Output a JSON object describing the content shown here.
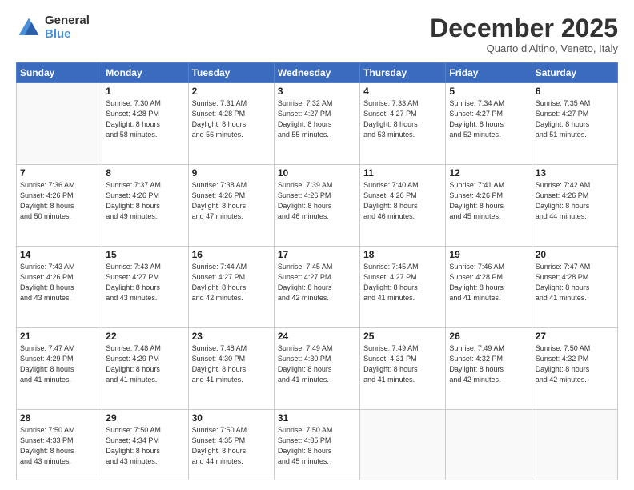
{
  "logo": {
    "general": "General",
    "blue": "Blue"
  },
  "header": {
    "month": "December 2025",
    "location": "Quarto d'Altino, Veneto, Italy"
  },
  "weekdays": [
    "Sunday",
    "Monday",
    "Tuesday",
    "Wednesday",
    "Thursday",
    "Friday",
    "Saturday"
  ],
  "weeks": [
    [
      {
        "day": "",
        "info": ""
      },
      {
        "day": "1",
        "info": "Sunrise: 7:30 AM\nSunset: 4:28 PM\nDaylight: 8 hours\nand 58 minutes."
      },
      {
        "day": "2",
        "info": "Sunrise: 7:31 AM\nSunset: 4:28 PM\nDaylight: 8 hours\nand 56 minutes."
      },
      {
        "day": "3",
        "info": "Sunrise: 7:32 AM\nSunset: 4:27 PM\nDaylight: 8 hours\nand 55 minutes."
      },
      {
        "day": "4",
        "info": "Sunrise: 7:33 AM\nSunset: 4:27 PM\nDaylight: 8 hours\nand 53 minutes."
      },
      {
        "day": "5",
        "info": "Sunrise: 7:34 AM\nSunset: 4:27 PM\nDaylight: 8 hours\nand 52 minutes."
      },
      {
        "day": "6",
        "info": "Sunrise: 7:35 AM\nSunset: 4:27 PM\nDaylight: 8 hours\nand 51 minutes."
      }
    ],
    [
      {
        "day": "7",
        "info": "Sunrise: 7:36 AM\nSunset: 4:26 PM\nDaylight: 8 hours\nand 50 minutes."
      },
      {
        "day": "8",
        "info": "Sunrise: 7:37 AM\nSunset: 4:26 PM\nDaylight: 8 hours\nand 49 minutes."
      },
      {
        "day": "9",
        "info": "Sunrise: 7:38 AM\nSunset: 4:26 PM\nDaylight: 8 hours\nand 47 minutes."
      },
      {
        "day": "10",
        "info": "Sunrise: 7:39 AM\nSunset: 4:26 PM\nDaylight: 8 hours\nand 46 minutes."
      },
      {
        "day": "11",
        "info": "Sunrise: 7:40 AM\nSunset: 4:26 PM\nDaylight: 8 hours\nand 46 minutes."
      },
      {
        "day": "12",
        "info": "Sunrise: 7:41 AM\nSunset: 4:26 PM\nDaylight: 8 hours\nand 45 minutes."
      },
      {
        "day": "13",
        "info": "Sunrise: 7:42 AM\nSunset: 4:26 PM\nDaylight: 8 hours\nand 44 minutes."
      }
    ],
    [
      {
        "day": "14",
        "info": "Sunrise: 7:43 AM\nSunset: 4:26 PM\nDaylight: 8 hours\nand 43 minutes."
      },
      {
        "day": "15",
        "info": "Sunrise: 7:43 AM\nSunset: 4:27 PM\nDaylight: 8 hours\nand 43 minutes."
      },
      {
        "day": "16",
        "info": "Sunrise: 7:44 AM\nSunset: 4:27 PM\nDaylight: 8 hours\nand 42 minutes."
      },
      {
        "day": "17",
        "info": "Sunrise: 7:45 AM\nSunset: 4:27 PM\nDaylight: 8 hours\nand 42 minutes."
      },
      {
        "day": "18",
        "info": "Sunrise: 7:45 AM\nSunset: 4:27 PM\nDaylight: 8 hours\nand 41 minutes."
      },
      {
        "day": "19",
        "info": "Sunrise: 7:46 AM\nSunset: 4:28 PM\nDaylight: 8 hours\nand 41 minutes."
      },
      {
        "day": "20",
        "info": "Sunrise: 7:47 AM\nSunset: 4:28 PM\nDaylight: 8 hours\nand 41 minutes."
      }
    ],
    [
      {
        "day": "21",
        "info": "Sunrise: 7:47 AM\nSunset: 4:29 PM\nDaylight: 8 hours\nand 41 minutes."
      },
      {
        "day": "22",
        "info": "Sunrise: 7:48 AM\nSunset: 4:29 PM\nDaylight: 8 hours\nand 41 minutes."
      },
      {
        "day": "23",
        "info": "Sunrise: 7:48 AM\nSunset: 4:30 PM\nDaylight: 8 hours\nand 41 minutes."
      },
      {
        "day": "24",
        "info": "Sunrise: 7:49 AM\nSunset: 4:30 PM\nDaylight: 8 hours\nand 41 minutes."
      },
      {
        "day": "25",
        "info": "Sunrise: 7:49 AM\nSunset: 4:31 PM\nDaylight: 8 hours\nand 41 minutes."
      },
      {
        "day": "26",
        "info": "Sunrise: 7:49 AM\nSunset: 4:32 PM\nDaylight: 8 hours\nand 42 minutes."
      },
      {
        "day": "27",
        "info": "Sunrise: 7:50 AM\nSunset: 4:32 PM\nDaylight: 8 hours\nand 42 minutes."
      }
    ],
    [
      {
        "day": "28",
        "info": "Sunrise: 7:50 AM\nSunset: 4:33 PM\nDaylight: 8 hours\nand 43 minutes."
      },
      {
        "day": "29",
        "info": "Sunrise: 7:50 AM\nSunset: 4:34 PM\nDaylight: 8 hours\nand 43 minutes."
      },
      {
        "day": "30",
        "info": "Sunrise: 7:50 AM\nSunset: 4:35 PM\nDaylight: 8 hours\nand 44 minutes."
      },
      {
        "day": "31",
        "info": "Sunrise: 7:50 AM\nSunset: 4:35 PM\nDaylight: 8 hours\nand 45 minutes."
      },
      {
        "day": "",
        "info": ""
      },
      {
        "day": "",
        "info": ""
      },
      {
        "day": "",
        "info": ""
      }
    ]
  ]
}
